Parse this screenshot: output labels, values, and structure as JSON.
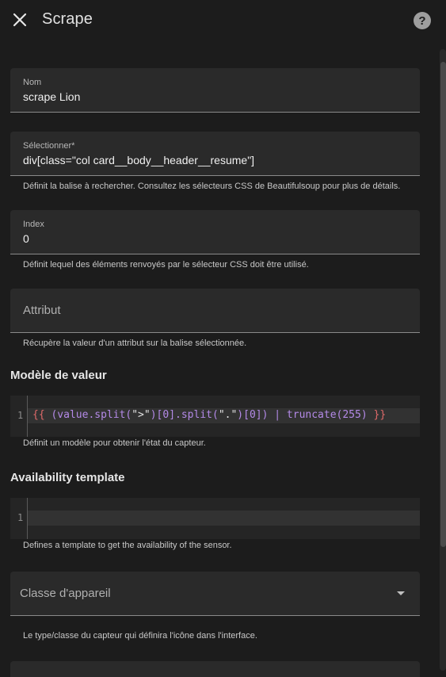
{
  "header": {
    "title": "Scrape"
  },
  "fields": {
    "nom": {
      "label": "Nom",
      "value": "scrape Lion"
    },
    "selector": {
      "label": "Sélectionner*",
      "value": "div[class=\"col card__body__header__resume\"]",
      "helper": "Définit la balise à rechercher. Consultez les sélecteurs CSS de Beautifulsoup pour plus de détails."
    },
    "index": {
      "label": "Index",
      "value": "0",
      "helper": "Définit lequel des éléments renvoyés par le sélecteur CSS doit être utilisé."
    },
    "attribut": {
      "placeholder": "Attribut",
      "helper": "Récupère la valeur d'un attribut sur la balise sélectionnée."
    }
  },
  "value_template": {
    "title": "Modèle de valeur",
    "line_number": "1",
    "code": {
      "open": "{{",
      "p1": " (value.split(",
      "s1": "\">\"",
      "p2": ")[0].split(",
      "s2": "\".\"",
      "p3": ")[0]) | truncate(",
      "num": "255",
      "p4": ") ",
      "close": "}}"
    },
    "helper": "Définit un modèle pour obtenir l'état du capteur."
  },
  "availability_template": {
    "title": "Availability template",
    "line_number": "1",
    "helper": "Defines a template to get the availability of the sensor."
  },
  "device_class": {
    "placeholder": "Classe d'appareil",
    "helper": "Le type/classe du capteur qui définira l'icône dans l'interface."
  },
  "icons": {
    "close": "close-icon",
    "help": "help-circle-icon",
    "dropdown": "chevron-down-icon"
  }
}
